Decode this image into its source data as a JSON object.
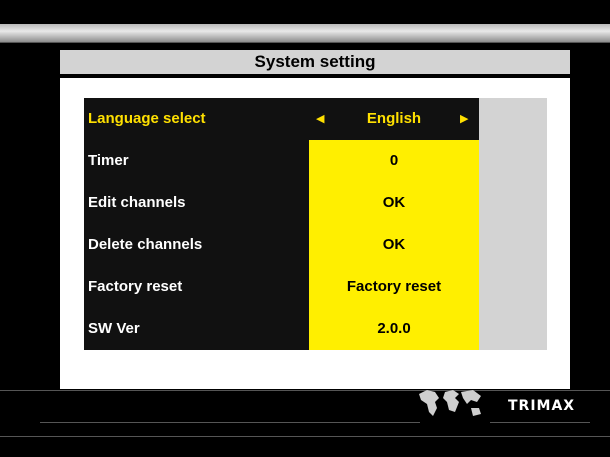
{
  "title": "System setting",
  "menu": [
    {
      "label": "Language select",
      "value": "English",
      "selected": true
    },
    {
      "label": "Timer",
      "value": "0",
      "selected": false
    },
    {
      "label": "Edit channels",
      "value": "OK",
      "selected": false
    },
    {
      "label": "Delete channels",
      "value": "OK",
      "selected": false
    },
    {
      "label": "Factory reset",
      "value": "Factory reset",
      "selected": false
    },
    {
      "label": "SW Ver",
      "value": "2.0.0",
      "selected": false
    }
  ],
  "brand": "TRIMAX",
  "icons": {
    "left": "triangle-left-icon",
    "right": "triangle-right-icon",
    "globe": "world-map-icon"
  },
  "colors": {
    "highlight": "#ffe000",
    "value_column": "#ffef00",
    "menu_bg": "#111111",
    "title_bg": "#d3d3d3"
  }
}
